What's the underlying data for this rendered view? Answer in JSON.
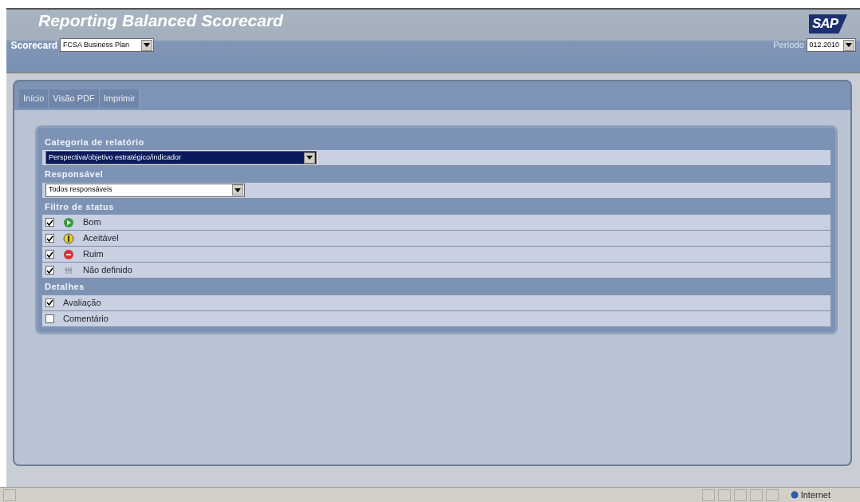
{
  "header": {
    "title": "Reporting Balanced Scorecard",
    "logo": "SAP",
    "scorecard": {
      "label": "Scorecard",
      "value": "FCSA Business Plan"
    },
    "period": {
      "label": "Período",
      "value": "012.2010"
    }
  },
  "tabs": [
    {
      "label": "Início",
      "selected": false
    },
    {
      "label": "Visão PDF",
      "selected": false
    },
    {
      "label": "Imprimir",
      "selected": false
    }
  ],
  "sections": [
    {
      "title": "Categoria de relatório",
      "kind": "select",
      "value": "Perspectiva/objetivo estratégico/indicador",
      "focused": true
    },
    {
      "title": "Responsável",
      "kind": "select",
      "value": "Todos responsáveis",
      "focused": false
    },
    {
      "title": "Filtro de status",
      "kind": "checks",
      "items": [
        {
          "label": "Bom",
          "checked": true,
          "kind": "good"
        },
        {
          "label": "Aceitável",
          "checked": true,
          "kind": "acceptable"
        },
        {
          "label": "Ruim",
          "checked": true,
          "kind": "bad"
        },
        {
          "label": "Não definido",
          "checked": true,
          "kind": "undefined"
        }
      ]
    },
    {
      "title": "Detalhes",
      "kind": "checks",
      "items": [
        {
          "label": "Avaliação",
          "checked": true
        },
        {
          "label": "Comentário",
          "checked": false
        }
      ]
    }
  ],
  "status_bar": {
    "zone": "Internet"
  }
}
